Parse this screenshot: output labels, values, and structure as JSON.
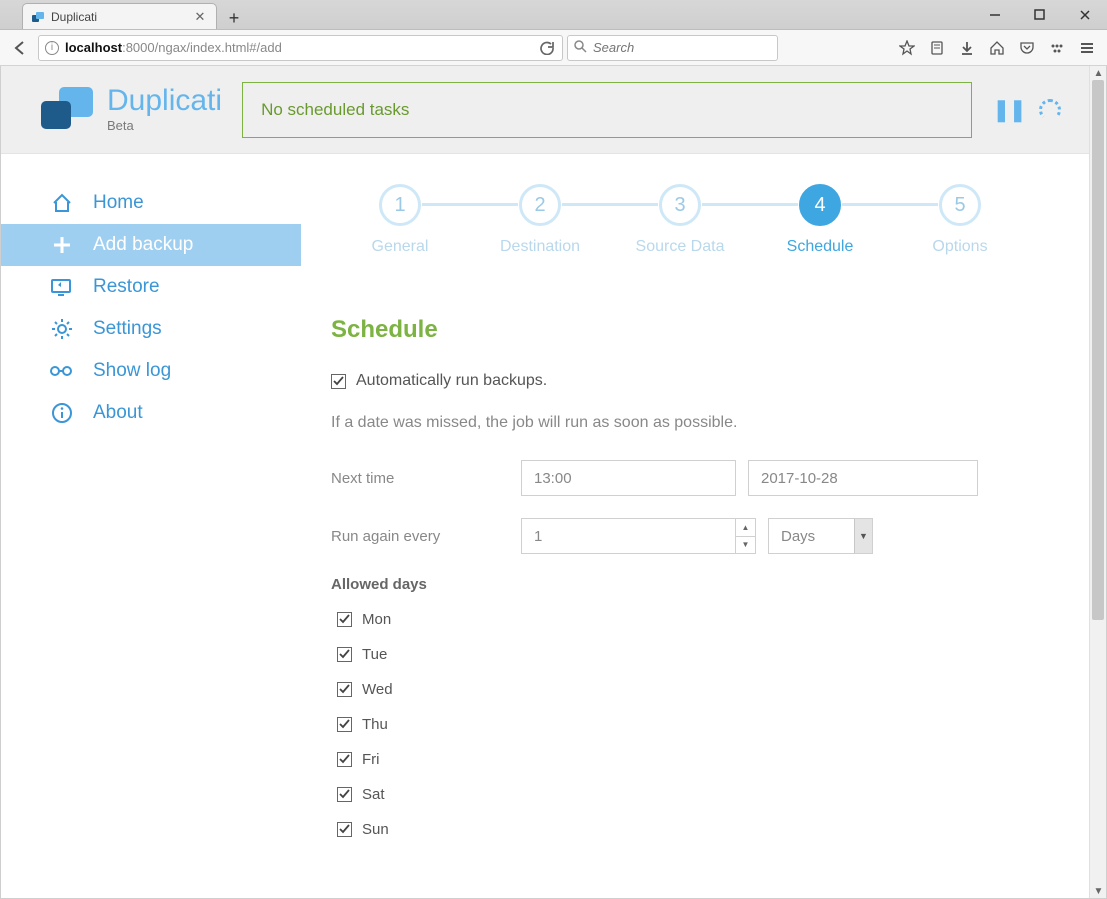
{
  "browser": {
    "tab_title": "Duplicati",
    "url_host": "localhost",
    "url_port": ":8000",
    "url_path": "/ngax/index.html#/add",
    "search_placeholder": "Search"
  },
  "brand": {
    "name": "Duplicati",
    "sub": "Beta"
  },
  "status": {
    "message": "No scheduled tasks"
  },
  "nav": {
    "home": "Home",
    "add": "Add backup",
    "restore": "Restore",
    "settings": "Settings",
    "log": "Show log",
    "about": "About"
  },
  "steps": {
    "s1": {
      "num": "1",
      "label": "General"
    },
    "s2": {
      "num": "2",
      "label": "Destination"
    },
    "s3": {
      "num": "3",
      "label": "Source Data"
    },
    "s4": {
      "num": "4",
      "label": "Schedule"
    },
    "s5": {
      "num": "5",
      "label": "Options"
    }
  },
  "schedule": {
    "title": "Schedule",
    "auto_label": "Automatically run backups.",
    "hint": "If a date was missed, the job will run as soon as possible.",
    "next_time_label": "Next time",
    "next_time_value": "13:00",
    "next_date_value": "2017-10-28",
    "repeat_label": "Run again every",
    "repeat_value": "1",
    "repeat_unit": "Days",
    "allowed_label": "Allowed days",
    "days": {
      "mon": "Mon",
      "tue": "Tue",
      "wed": "Wed",
      "thu": "Thu",
      "fri": "Fri",
      "sat": "Sat",
      "sun": "Sun"
    }
  }
}
